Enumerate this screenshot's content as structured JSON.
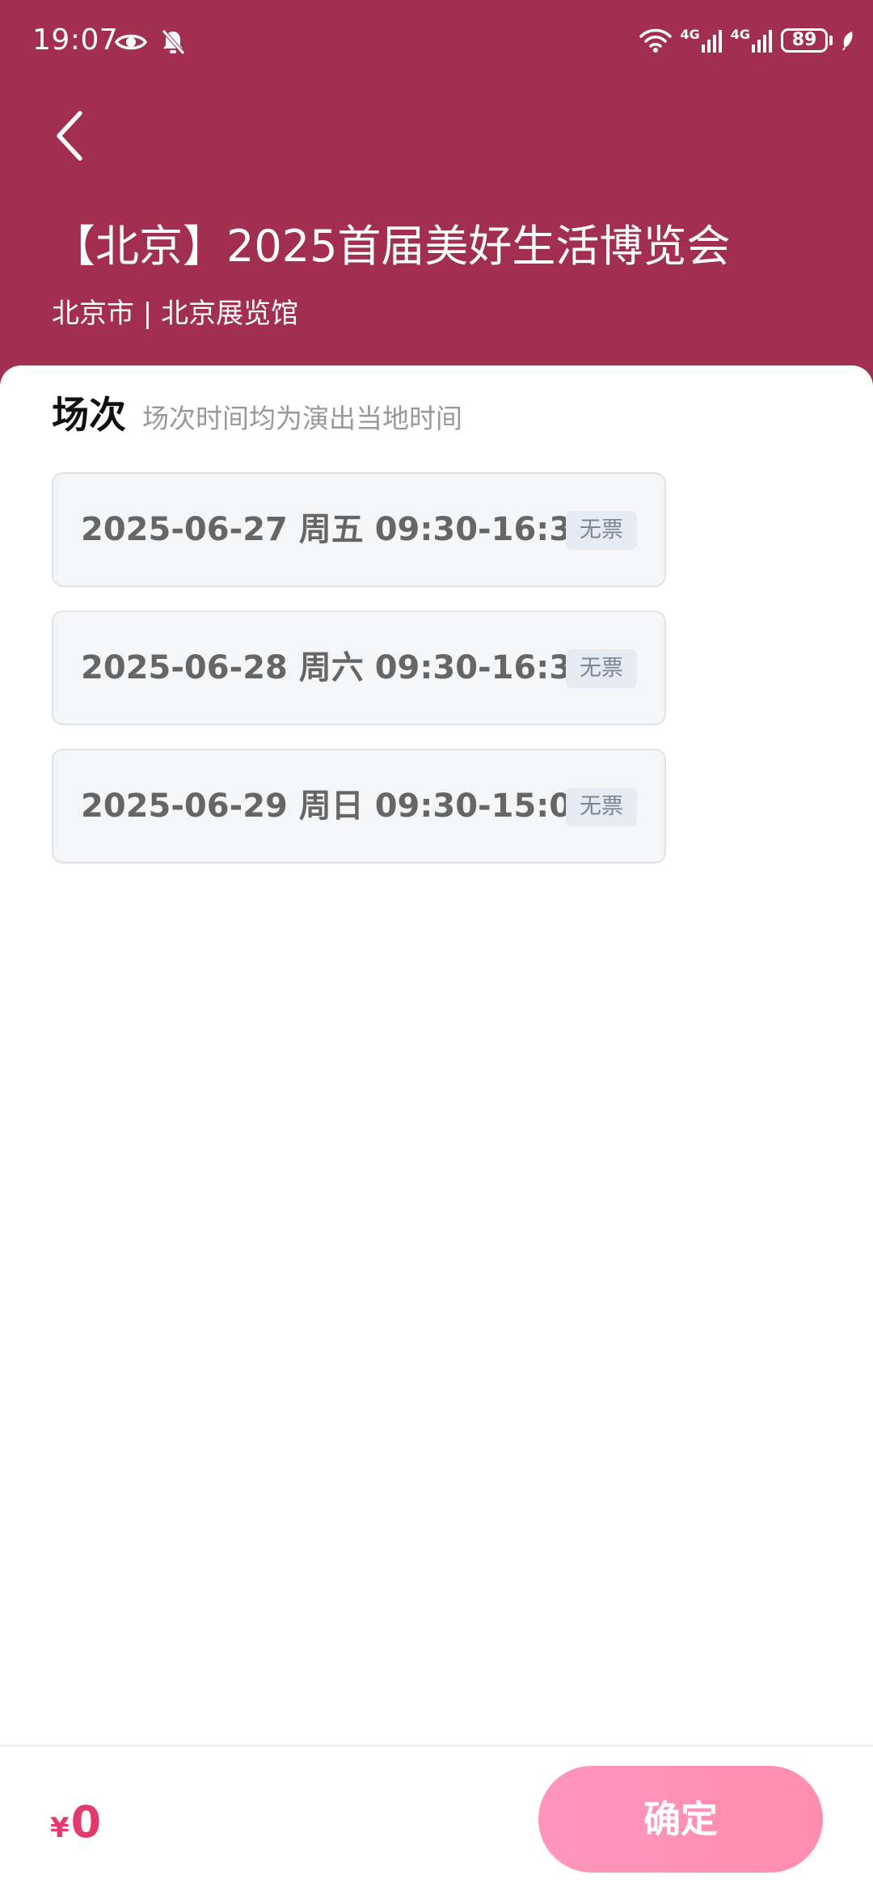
{
  "status_bar": {
    "time": "19:07",
    "network_1": "4G",
    "network_2": "4G",
    "battery": "89",
    "icons": [
      "eye-icon",
      "bell-off-icon",
      "wifi-icon",
      "signal-icon",
      "battery-icon",
      "leaf-icon"
    ]
  },
  "header": {
    "back_icon": "chevron-left-icon",
    "title": "【北京】2025首届美好生活博览会",
    "venue": "北京市 | 北京展览馆",
    "background_color": "#a22e50"
  },
  "section": {
    "title": "场次",
    "note": "场次时间均为演出当地时间"
  },
  "sessions": [
    {
      "label": "2025-06-27 周五 09:30-16:30",
      "status": "无票"
    },
    {
      "label": "2025-06-28 周六 09:30-16:30",
      "status": "无票"
    },
    {
      "label": "2025-06-29 周日 09:30-15:00",
      "status": "无票"
    }
  ],
  "footer": {
    "currency": "¥",
    "price": "0",
    "confirm_label": "确定",
    "price_color": "#e4396d",
    "button_color": "#ff8fb3"
  }
}
